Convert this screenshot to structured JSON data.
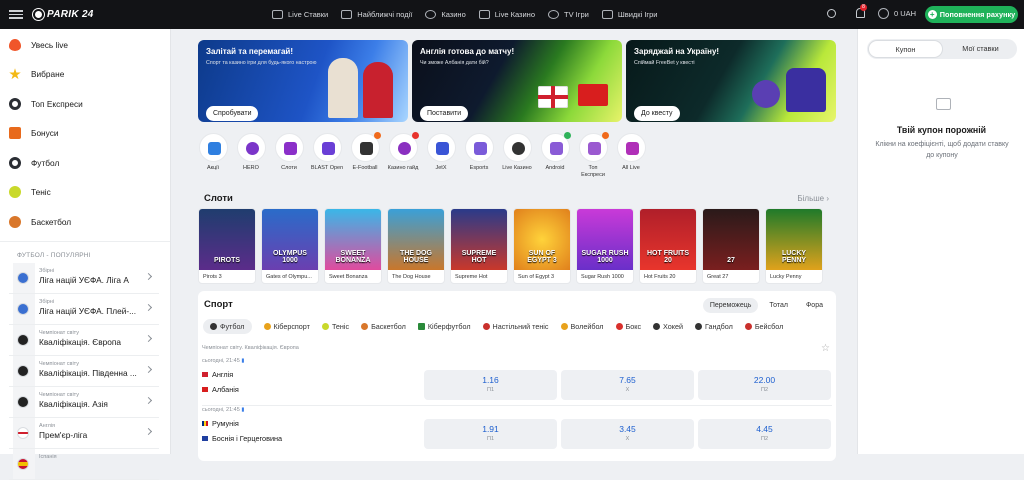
{
  "header": {
    "brand": "PARIK 24",
    "nav": [
      "Live Ставки",
      "Найближчі події",
      "Казино",
      "Live Казино",
      "TV Ігри",
      "Швидкі Ігри"
    ],
    "notification_count": "8",
    "balance": "0 UAH",
    "deposit_label": "Поповнення рахунку"
  },
  "sidebar": {
    "items": [
      {
        "label": "Увесь live",
        "icon": "fire-icon",
        "color": "#f0562a"
      },
      {
        "label": "Вибране",
        "icon": "star-icon",
        "color": "#f3b915"
      },
      {
        "label": "Топ Експреси",
        "icon": "top-express-icon",
        "color": "#2b2e34"
      },
      {
        "label": "Бонуси",
        "icon": "gift-icon",
        "color": "#e86a1c"
      },
      {
        "label": "Футбол",
        "icon": "football-icon",
        "color": "#2b2e34"
      },
      {
        "label": "Теніс",
        "icon": "tennis-icon",
        "color": "#c9d92b"
      },
      {
        "label": "Баскетбол",
        "icon": "basketball-icon",
        "color": "#d9772b"
      }
    ],
    "popular_heading": "ФУТБОЛ - ПОПУЛЯРНІ",
    "leagues": [
      {
        "sup": "Збірні",
        "name": "Ліга націй УЄФА. Ліга А"
      },
      {
        "sup": "Збірні",
        "name": "Ліга націй УЄФА. Плей-..."
      },
      {
        "sup": "Чемпіонат світу",
        "name": "Кваліфікація. Європа"
      },
      {
        "sup": "Чемпіонат світу",
        "name": "Кваліфікація. Південна ..."
      },
      {
        "sup": "Чемпіонат світу",
        "name": "Кваліфікація. Азія"
      },
      {
        "sup": "Англія",
        "name": "Прем'єр-ліга"
      },
      {
        "sup": "Іспанія",
        "name": ""
      }
    ]
  },
  "banners": [
    {
      "title": "Залітай та перемагай!",
      "text": "Спорт та казино ігри для будь-якого настрою",
      "button": "Спробувати"
    },
    {
      "title": "Англія готова до матчу!",
      "text": "Чи зможе Албанія дати бій?",
      "button": "Поставити"
    },
    {
      "title": "Заряджай на Україну!",
      "text": "Спіймай FreeBet у квесті",
      "button": "До квесту"
    }
  ],
  "quick_links": [
    "Акції",
    "HERO",
    "Слоти",
    "BLAST Open",
    "E-Football",
    "Казино гайд",
    "JetX",
    "Esports",
    "Live Казино",
    "Android",
    "Топ Експреси",
    "All Live"
  ],
  "slots": {
    "title": "Слоти",
    "more": "Більше",
    "games": [
      {
        "name": "Pirots 3",
        "art": "PIROTS"
      },
      {
        "name": "Gates of Olympu...",
        "art": "OLYMPUS 1000"
      },
      {
        "name": "Sweet Bonanza",
        "art": "SWEET BONANZA"
      },
      {
        "name": "The Dog House",
        "art": "THE DOG HOUSE"
      },
      {
        "name": "Supreme Hot",
        "art": "SUPREME HOT"
      },
      {
        "name": "Sun of Egypt 3",
        "art": "SUN OF EGYPT 3"
      },
      {
        "name": "Sugar Rush 1000",
        "art": "SUGAR RUSH 1000"
      },
      {
        "name": "Hot Fruits 20",
        "art": "HOT FRUITS 20"
      },
      {
        "name": "Great 27",
        "art": "27"
      },
      {
        "name": "Lucky Penny",
        "art": "LUCKY PENNY"
      }
    ]
  },
  "sport": {
    "title": "Спорт",
    "tabs": [
      "Переможець",
      "Тотал",
      "Фора"
    ],
    "sports": [
      "Футбол",
      "Кіберспорт",
      "Теніс",
      "Баскетбол",
      "Кіберфутбол",
      "Настільний теніс",
      "Волейбол",
      "Бокс",
      "Хокей",
      "Гандбол",
      "Бейсбол"
    ],
    "championship": "Чемпіонат світу. Кваліфікація. Європа",
    "matches": [
      {
        "time": "сьогодні, 21:45",
        "home": "Англія",
        "away": "Албанія",
        "odds": [
          {
            "v": "1.16",
            "k": "П1"
          },
          {
            "v": "7.65",
            "k": "Х"
          },
          {
            "v": "22.00",
            "k": "П2"
          }
        ]
      },
      {
        "time": "сьогодні, 21:45",
        "home": "Румунія",
        "away": "Боснія і Герцеговина",
        "odds": [
          {
            "v": "1.91",
            "k": "П1"
          },
          {
            "v": "3.45",
            "k": "Х"
          },
          {
            "v": "4.45",
            "k": "П2"
          }
        ]
      }
    ]
  },
  "coupon": {
    "tabs": [
      "Купон",
      "Мої ставки"
    ],
    "empty_title": "Твій купон порожній",
    "empty_text": "Клікни на коефіцієнті, щоб додати ставку до купону"
  }
}
